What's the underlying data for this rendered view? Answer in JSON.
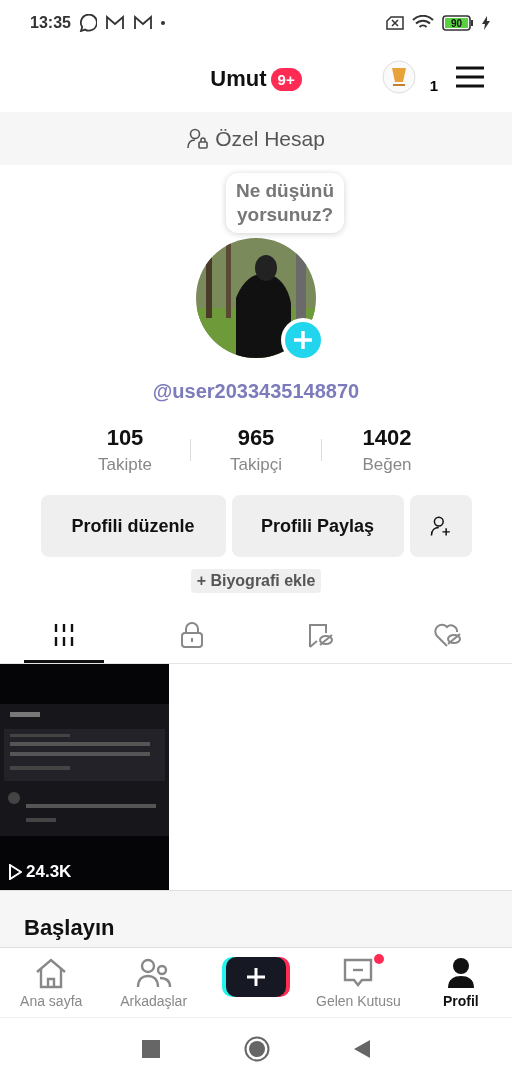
{
  "status_bar": {
    "time": "13:35",
    "battery": "90"
  },
  "header": {
    "name": "Umut",
    "badge": "9+",
    "coin_count": "1"
  },
  "account_banner": {
    "label": "Özel Hesap"
  },
  "profile": {
    "bubble": "Ne düşünü yorsunuz?",
    "username": "@user2033435148870"
  },
  "stats": [
    {
      "value": "105",
      "label": "Takipte"
    },
    {
      "value": "965",
      "label": "Takipçi"
    },
    {
      "value": "1402",
      "label": "Beğen"
    }
  ],
  "actions": [
    {
      "label": "Profili düzenle"
    },
    {
      "label": "Profili Paylaş"
    }
  ],
  "bio_button": "+ Biyografi ekle",
  "tabs": [
    {
      "kind": "grid",
      "selected": true
    },
    {
      "kind": "lock",
      "selected": false
    },
    {
      "kind": "saved",
      "selected": false
    },
    {
      "kind": "liked",
      "selected": false
    }
  ],
  "videos": [
    {
      "kind": "picture",
      "views": "24.3K"
    }
  ],
  "start_panel": {
    "title": "Başlayın"
  },
  "bottom_nav": [
    {
      "kind": "home",
      "label": "Ana sayfa",
      "selected": false,
      "dot": false
    },
    {
      "kind": "friends",
      "label": "Arkadaşlar",
      "selected": false,
      "dot": false
    },
    {
      "kind": "create"
    },
    {
      "kind": "inbox",
      "label": "Gelen Kutusu",
      "selected": false,
      "dot": true
    },
    {
      "kind": "profile",
      "label": "Profil",
      "selected": true,
      "dot": false
    }
  ]
}
